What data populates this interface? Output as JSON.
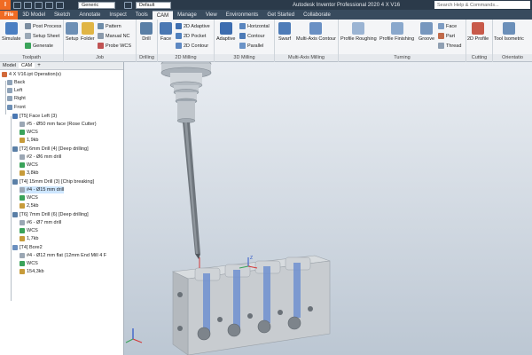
{
  "titlebar": {
    "logo": "I",
    "appearance_combo": "Generic",
    "material_combo": "Default",
    "app_title": "Autodesk Inventor Professional 2020   4 X V16",
    "search_placeholder": "Search Help & Commands..."
  },
  "tabs": [
    "File",
    "3D Model",
    "Sketch",
    "Annotate",
    "Inspect",
    "Tools",
    "CAM",
    "Manage",
    "View",
    "Environments",
    "Get Started",
    "Collaborate"
  ],
  "active_tab": "CAM",
  "ribbon": {
    "toolpath": {
      "name": "Toolpath",
      "simulate": "Simulate",
      "post_process": "Post Process",
      "setup_sheet": "Setup Sheet",
      "generate": "Generate"
    },
    "job": {
      "name": "Job",
      "setup": "Setup",
      "folder": "Folder",
      "pattern": "Pattern",
      "manual_nc": "Manual NC",
      "probe_wcs": "Probe WCS"
    },
    "drilling": {
      "name": "Drilling",
      "drill": "Drill"
    },
    "milling_2d": {
      "name": "2D Milling",
      "face": "Face",
      "adaptive_2d": "2D Adaptive",
      "pocket_2d": "2D Pocket",
      "contour_2d": "2D Contour"
    },
    "milling_3d": {
      "name": "3D Milling",
      "adaptive": "Adaptive",
      "horizontal": "Horizontal",
      "contour": "Contour",
      "parallel": "Parallel"
    },
    "multi_axis": {
      "name": "Multi-Axis Milling",
      "swarf": "Swarf",
      "multi_axis_contour": "Multi-Axis Contour"
    },
    "turning": {
      "name": "Turning",
      "profile_roughing": "Profile Roughing",
      "profile_finishing": "Profile Finishing",
      "groove": "Groove",
      "face": "Face",
      "part": "Part",
      "thread": "Thread"
    },
    "cutting": {
      "name": "Cutting",
      "profile_2d": "2D Profile"
    },
    "orientation": {
      "name": "Orientatio",
      "tool_isometric": "Tool Isometric"
    }
  },
  "browser": {
    "tab_model": "Model",
    "tab_cam": "CAM",
    "rows": [
      "4 X V16.ipt Operation(s)",
      "Back",
      "Left",
      "Right",
      "Front",
      "[T5] Face Left (3)",
      "#5 - Ø50 mm face (Rose Cutter)",
      "WCS",
      "1,9kb",
      "[T2] 6mm Drill (4) [Deep drilling]",
      "#2 - Ø6 mm drill",
      "WCS",
      "3,8kb",
      "[T4] 15mm Drill (3) [Chip breaking]",
      "#4 - Ø15 mm drill",
      "WCS",
      "2,5kb",
      "[T6] 7mm Drill (6) [Deep drilling]",
      "#6 - Ø7 mm drill",
      "WCS",
      "1,7kb",
      "[T4] Bore2",
      "#4 - Ø12 mm flat (12mm End Mill 4 F",
      "WCS",
      "154,3kb"
    ]
  },
  "viewport": {
    "axis_x": "X",
    "axis_y": "Y",
    "axis_z": "Z"
  }
}
